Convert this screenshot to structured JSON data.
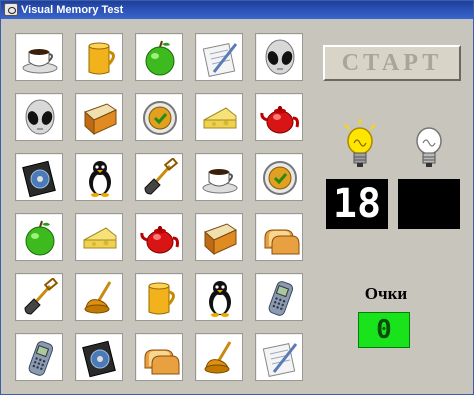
{
  "window": {
    "title": "Visual Memory Test"
  },
  "controls": {
    "start_label": "СТАРТ"
  },
  "counter": {
    "value": "18",
    "second_value": ""
  },
  "score": {
    "label": "Очки",
    "value": "0"
  },
  "board": {
    "rows": [
      [
        "coffee-cup-icon",
        "yellow-mug-icon",
        "green-apple-icon",
        "notepad-pen-icon",
        "alien-head-icon"
      ],
      [
        "alien-head-icon",
        "orange-book-icon",
        "clock-icon",
        "cheese-icon",
        "red-teapot-icon"
      ],
      [
        "cd-case-icon",
        "penguin-icon",
        "shovel-icon",
        "coffee-cup-icon",
        "clock-icon"
      ],
      [
        "green-apple-icon",
        "cheese-icon",
        "red-teapot-icon",
        "orange-book-icon",
        "toast-icon"
      ],
      [
        "shovel-icon",
        "plunger-icon",
        "yellow-mug-icon",
        "penguin-icon",
        "mobile-phone-icon"
      ],
      [
        "mobile-phone-icon",
        "cd-case-icon",
        "toast-icon",
        "plunger-icon",
        "notepad-pen-icon"
      ]
    ]
  },
  "colors": {
    "titlebar": "#1e3f9a",
    "score_bg": "#19e31b",
    "counter_bg": "#000000",
    "bulb_lit": "#ffe000"
  }
}
